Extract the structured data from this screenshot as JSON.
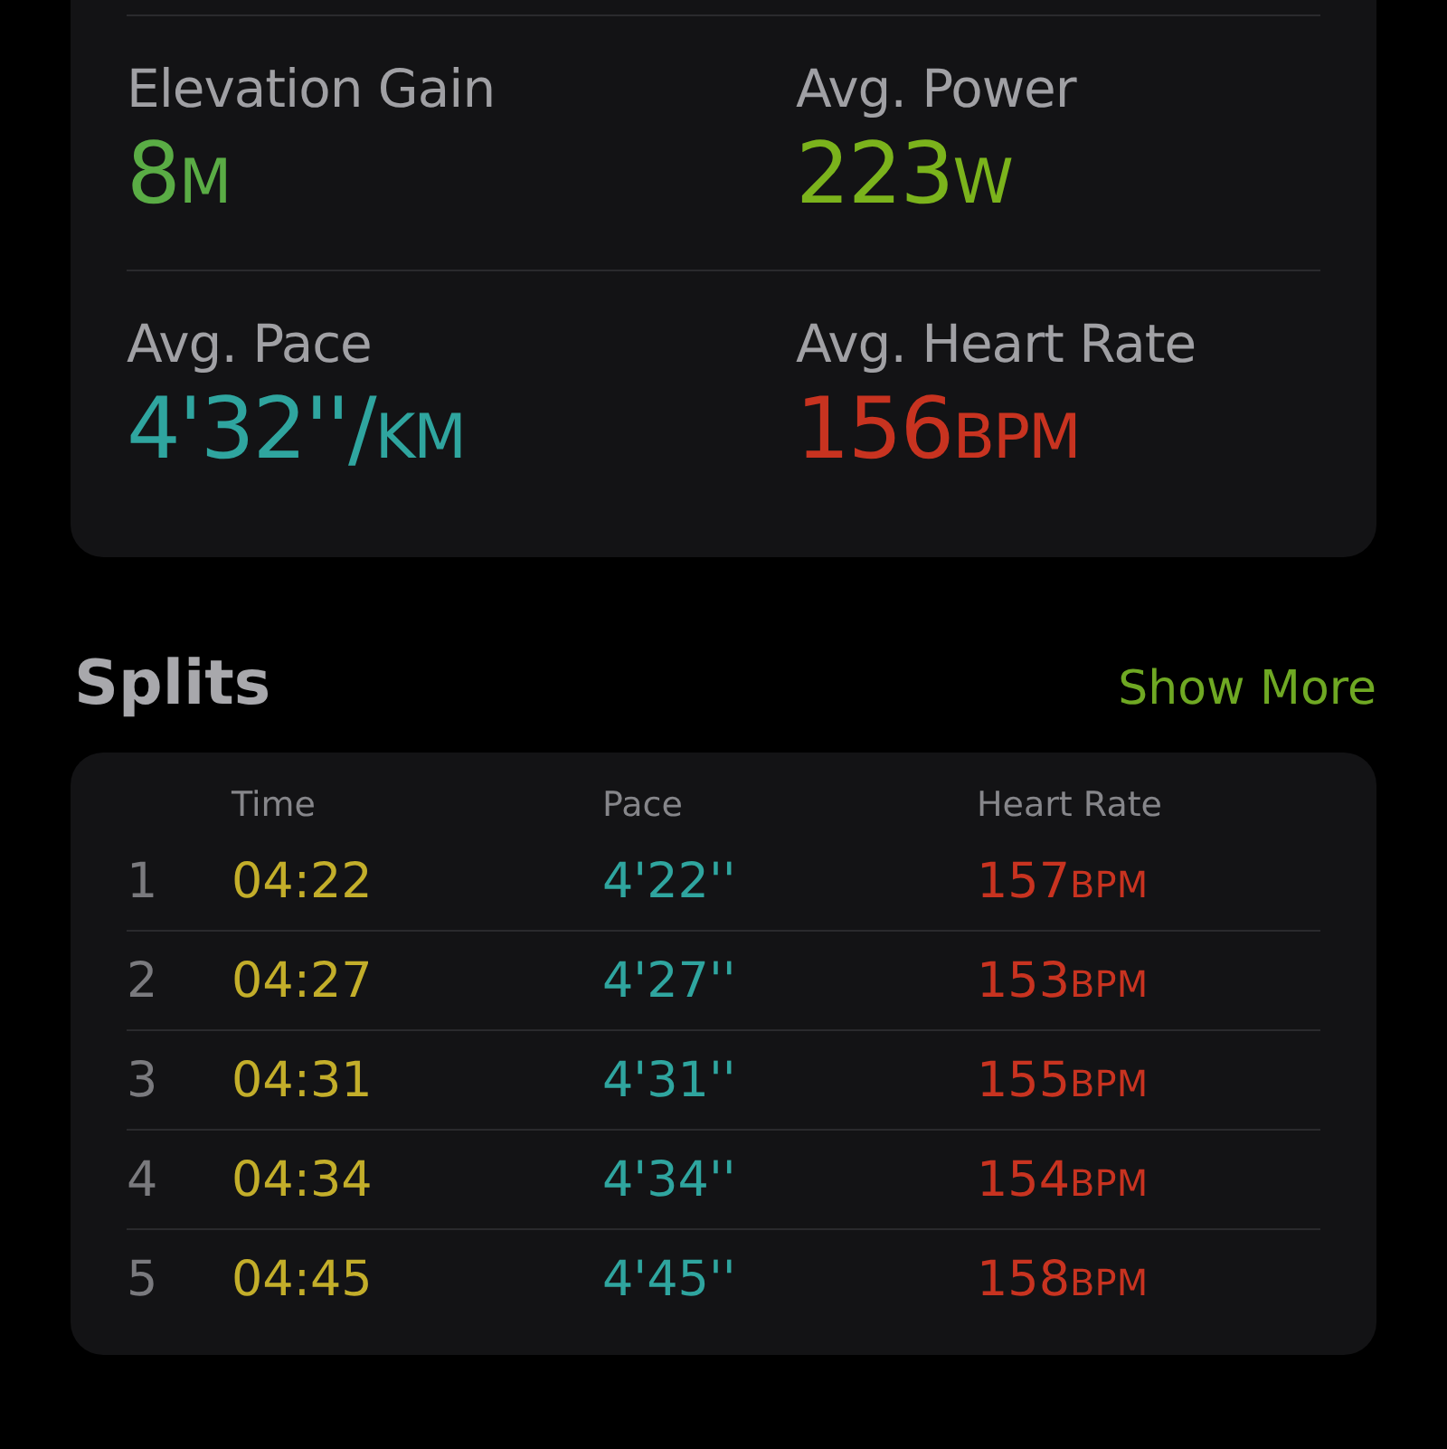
{
  "stats": [
    {
      "label": "Elevation Gain",
      "value": "8",
      "unit": "M",
      "color": "#5aac45"
    },
    {
      "label": "Avg. Power",
      "value": "223",
      "unit": "W",
      "color": "#7bb31c"
    },
    {
      "label": "Avg. Pace",
      "value": "4'32''/",
      "unit": "KM",
      "color": "#2fa59f"
    },
    {
      "label": "Avg. Heart Rate",
      "value": "156",
      "unit": "BPM",
      "color": "#c83320"
    }
  ],
  "splits": {
    "title": "Splits",
    "show_more": "Show More",
    "columns": [
      "Time",
      "Pace",
      "Heart Rate"
    ],
    "rows": [
      {
        "index": "1",
        "time": "04:22",
        "pace": "4'22''",
        "heart_rate": "157",
        "unit": "BPM"
      },
      {
        "index": "2",
        "time": "04:27",
        "pace": "4'27''",
        "heart_rate": "153",
        "unit": "BPM"
      },
      {
        "index": "3",
        "time": "04:31",
        "pace": "4'31''",
        "heart_rate": "155",
        "unit": "BPM"
      },
      {
        "index": "4",
        "time": "04:34",
        "pace": "4'34''",
        "heart_rate": "154",
        "unit": "BPM"
      },
      {
        "index": "5",
        "time": "04:45",
        "pace": "4'45''",
        "heart_rate": "158",
        "unit": "BPM"
      }
    ]
  }
}
